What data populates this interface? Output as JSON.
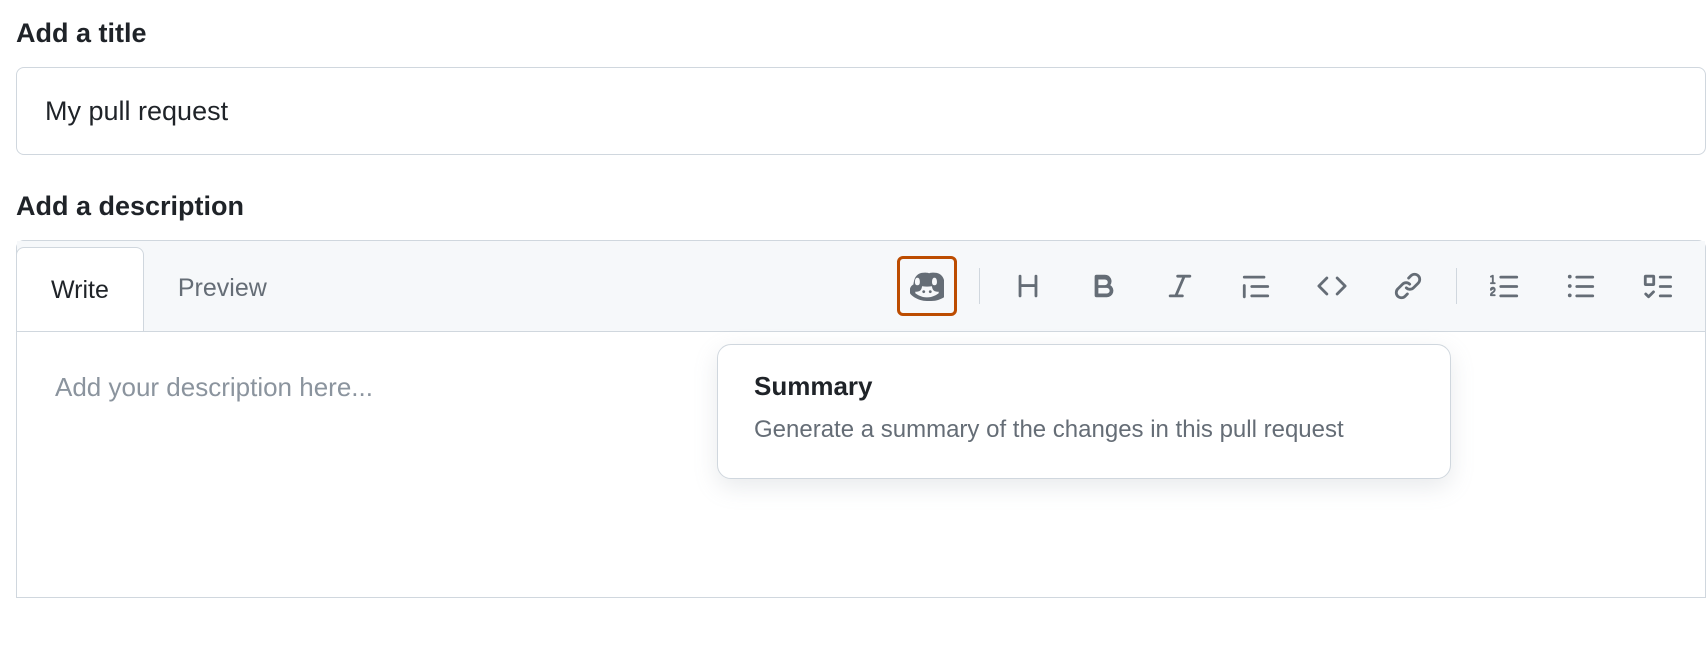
{
  "title_section": {
    "label": "Add a title",
    "value": "My pull request"
  },
  "description_section": {
    "label": "Add a description",
    "tabs": {
      "write": "Write",
      "preview": "Preview"
    },
    "placeholder": "Add your description here...",
    "value": ""
  },
  "toolbar_icons": {
    "copilot": "copilot-icon",
    "heading": "heading-icon",
    "bold": "bold-icon",
    "italic": "italic-icon",
    "quote": "quote-icon",
    "code": "code-icon",
    "link": "link-icon",
    "ordered_list": "ordered-list-icon",
    "unordered_list": "unordered-list-icon",
    "task_list": "task-list-icon"
  },
  "popover": {
    "title": "Summary",
    "description": "Generate a summary of the changes in this pull request"
  }
}
